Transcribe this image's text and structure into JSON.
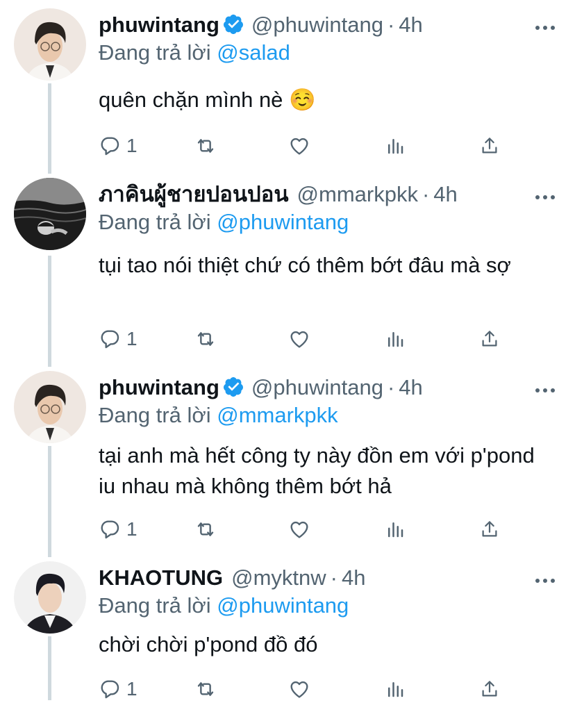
{
  "tweets": [
    {
      "name": "phuwintang",
      "verified": true,
      "handle": "@phuwintang",
      "dot": "·",
      "time": "4h",
      "reply_prefix": "Đang trả lời",
      "reply_mention": "@salad",
      "text": "quên chặn mình nè ☺️",
      "reply_count": "1"
    },
    {
      "name": "ภาคินผู้ชายปอนปอน",
      "verified": false,
      "handle": "@mmarkpkk",
      "dot": "·",
      "time": "4h",
      "reply_prefix": "Đang trả lời",
      "reply_mention": "@phuwintang",
      "text": "tụi tao nói thiệt chứ có thêm bớt đâu mà sợ",
      "reply_count": "1"
    },
    {
      "name": "phuwintang",
      "verified": true,
      "handle": "@phuwintang",
      "dot": "·",
      "time": "4h",
      "reply_prefix": "Đang trả lời",
      "reply_mention": "@mmarkpkk",
      "text": "tại anh mà hết công ty này đồn em với p'pond iu nhau mà không thêm bớt hả",
      "reply_count": "1"
    },
    {
      "name": "KHAOTUNG",
      "verified": false,
      "handle": "@myktnw",
      "dot": "·",
      "time": "4h",
      "reply_prefix": "Đang trả lời",
      "reply_mention": "@phuwintang",
      "text": "chời chời p'pond đồ đó",
      "reply_count": "1"
    }
  ],
  "icons": {
    "reply": "comment-icon",
    "retweet": "retweet-icon",
    "like": "heart-icon",
    "stats": "analytics-icon",
    "share": "share-icon",
    "more": "more-icon",
    "verified": "verified-badge-icon"
  },
  "colors": {
    "accent": "#1d9bf0",
    "secondary_text": "#536471",
    "thread_line": "#cfd9de"
  }
}
